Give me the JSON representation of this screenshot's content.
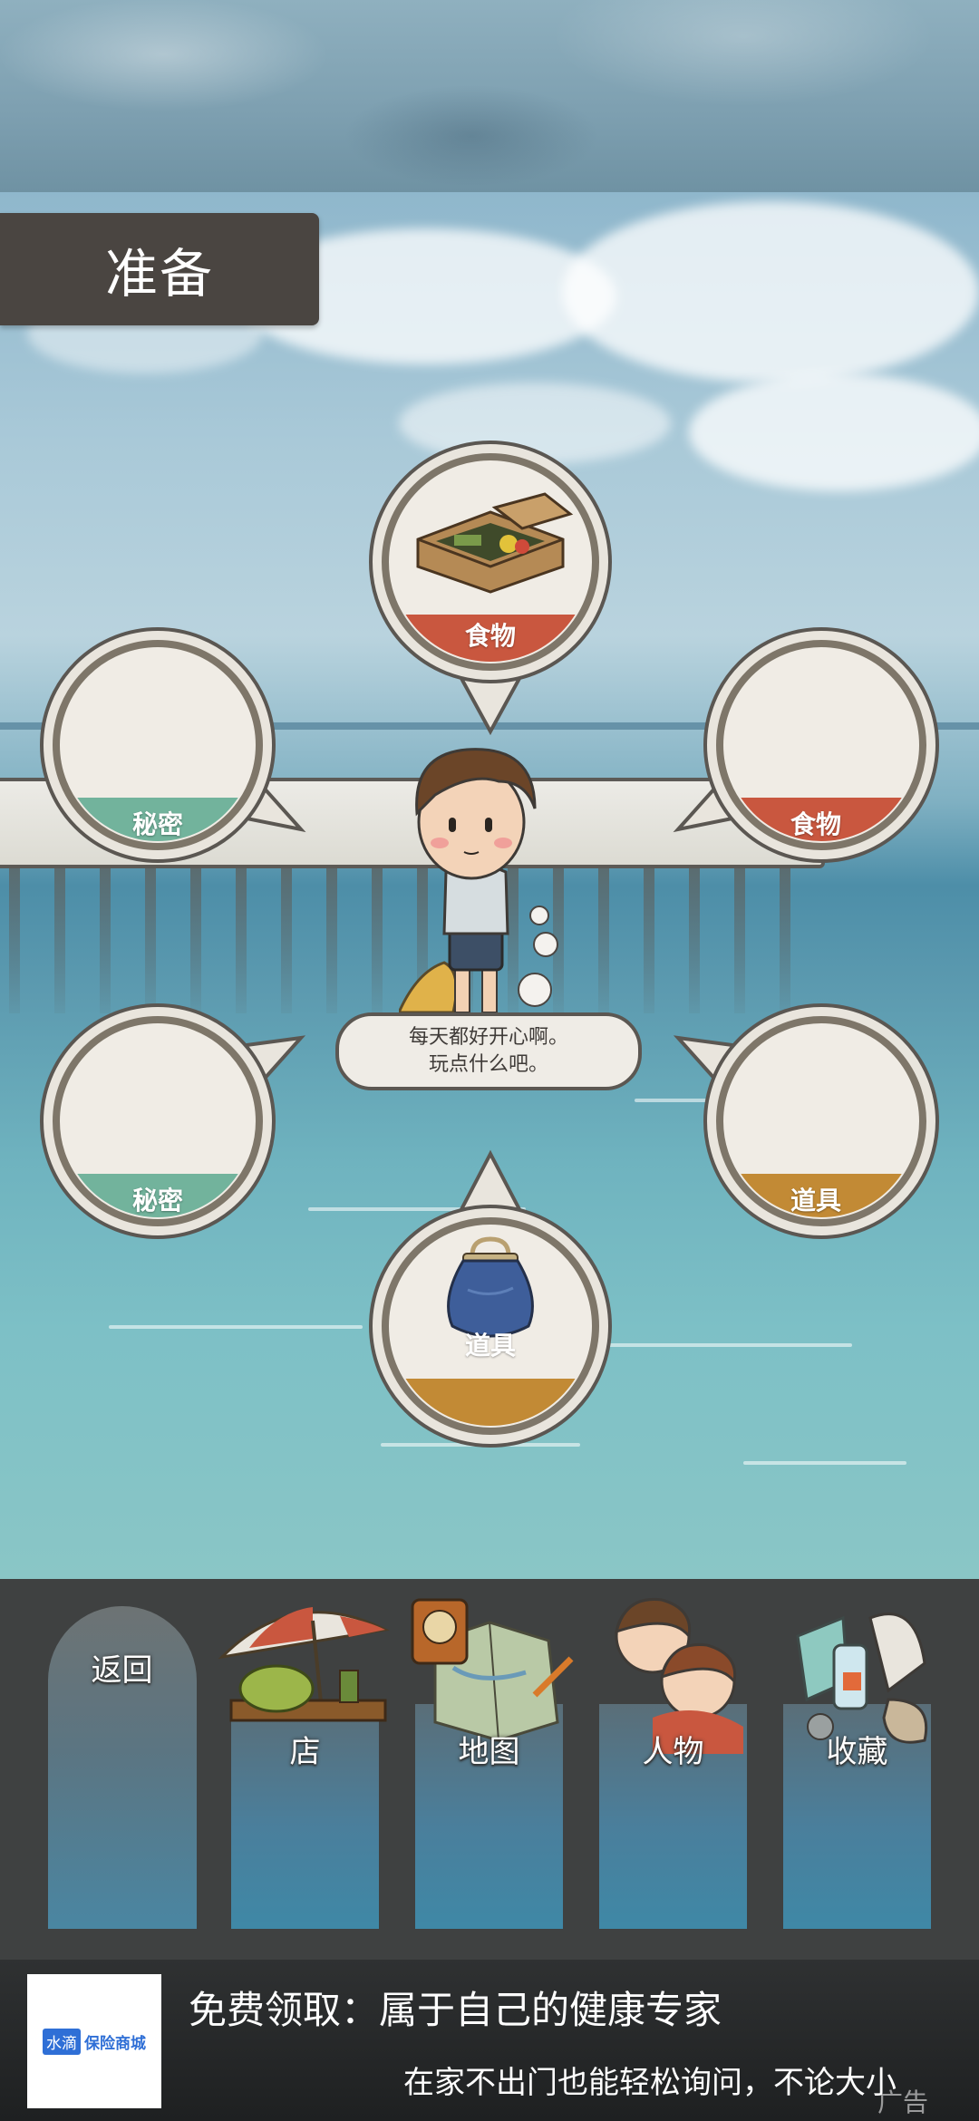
{
  "header": {
    "title": "准备"
  },
  "slots": {
    "top": {
      "label": "食物",
      "band_color": "#c9573f",
      "icon": "bento-box-icon"
    },
    "upper_left": {
      "label": "秘密",
      "band_color": "#72b39c"
    },
    "upper_right": {
      "label": "食物",
      "band_color": "#c9573f"
    },
    "lower_left": {
      "label": "秘密",
      "band_color": "#72b39c"
    },
    "lower_right": {
      "label": "道具",
      "band_color": "#c28a35"
    },
    "bottom": {
      "label": "道具",
      "band_color": "#c28a35",
      "icon": "coin-purse-icon"
    }
  },
  "speech": {
    "line1": "每天都好开心啊。",
    "line2": "玩点什么吧。"
  },
  "nav": {
    "back": "返回",
    "shop": "店",
    "map": "地图",
    "people": "人物",
    "collection": "收藏"
  },
  "ad": {
    "logo_badge": "水滴",
    "logo_text": "保险商城",
    "title": "免费领取：属于自己的健康专家",
    "subtitle": "在家不出门也能轻松询问，不论大小",
    "tag": "广告"
  }
}
